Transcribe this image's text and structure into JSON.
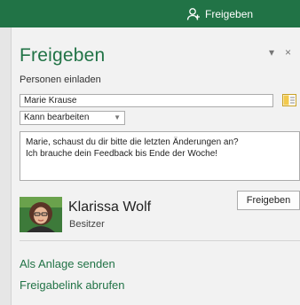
{
  "header": {
    "share_label": "Freigeben"
  },
  "panel": {
    "title": "Freigeben",
    "controls": {
      "dropdown": "▾",
      "close": "×"
    },
    "invite_label": "Personen einladen",
    "invite_input_value": "Marie Krause",
    "permission_value": "Kann bearbeiten",
    "message_value": "Marie, schaust du dir bitte die letzten Änderungen an?\nIch brauche dein Feedback bis Ende der Woche!",
    "share_button_label": "Freigeben",
    "owner": {
      "name": "Klarissa Wolf",
      "role": "Besitzer"
    },
    "links": {
      "attachment": "Als Anlage senden",
      "share_link": "Freigabelink abrufen"
    }
  },
  "colors": {
    "accent": "#217346",
    "panel_bg": "#f2f2f2",
    "address_book": "#f2c94c"
  },
  "icons": {
    "share": "person-add-icon",
    "address_book": "address-book-icon",
    "avatar": "user-avatar"
  }
}
